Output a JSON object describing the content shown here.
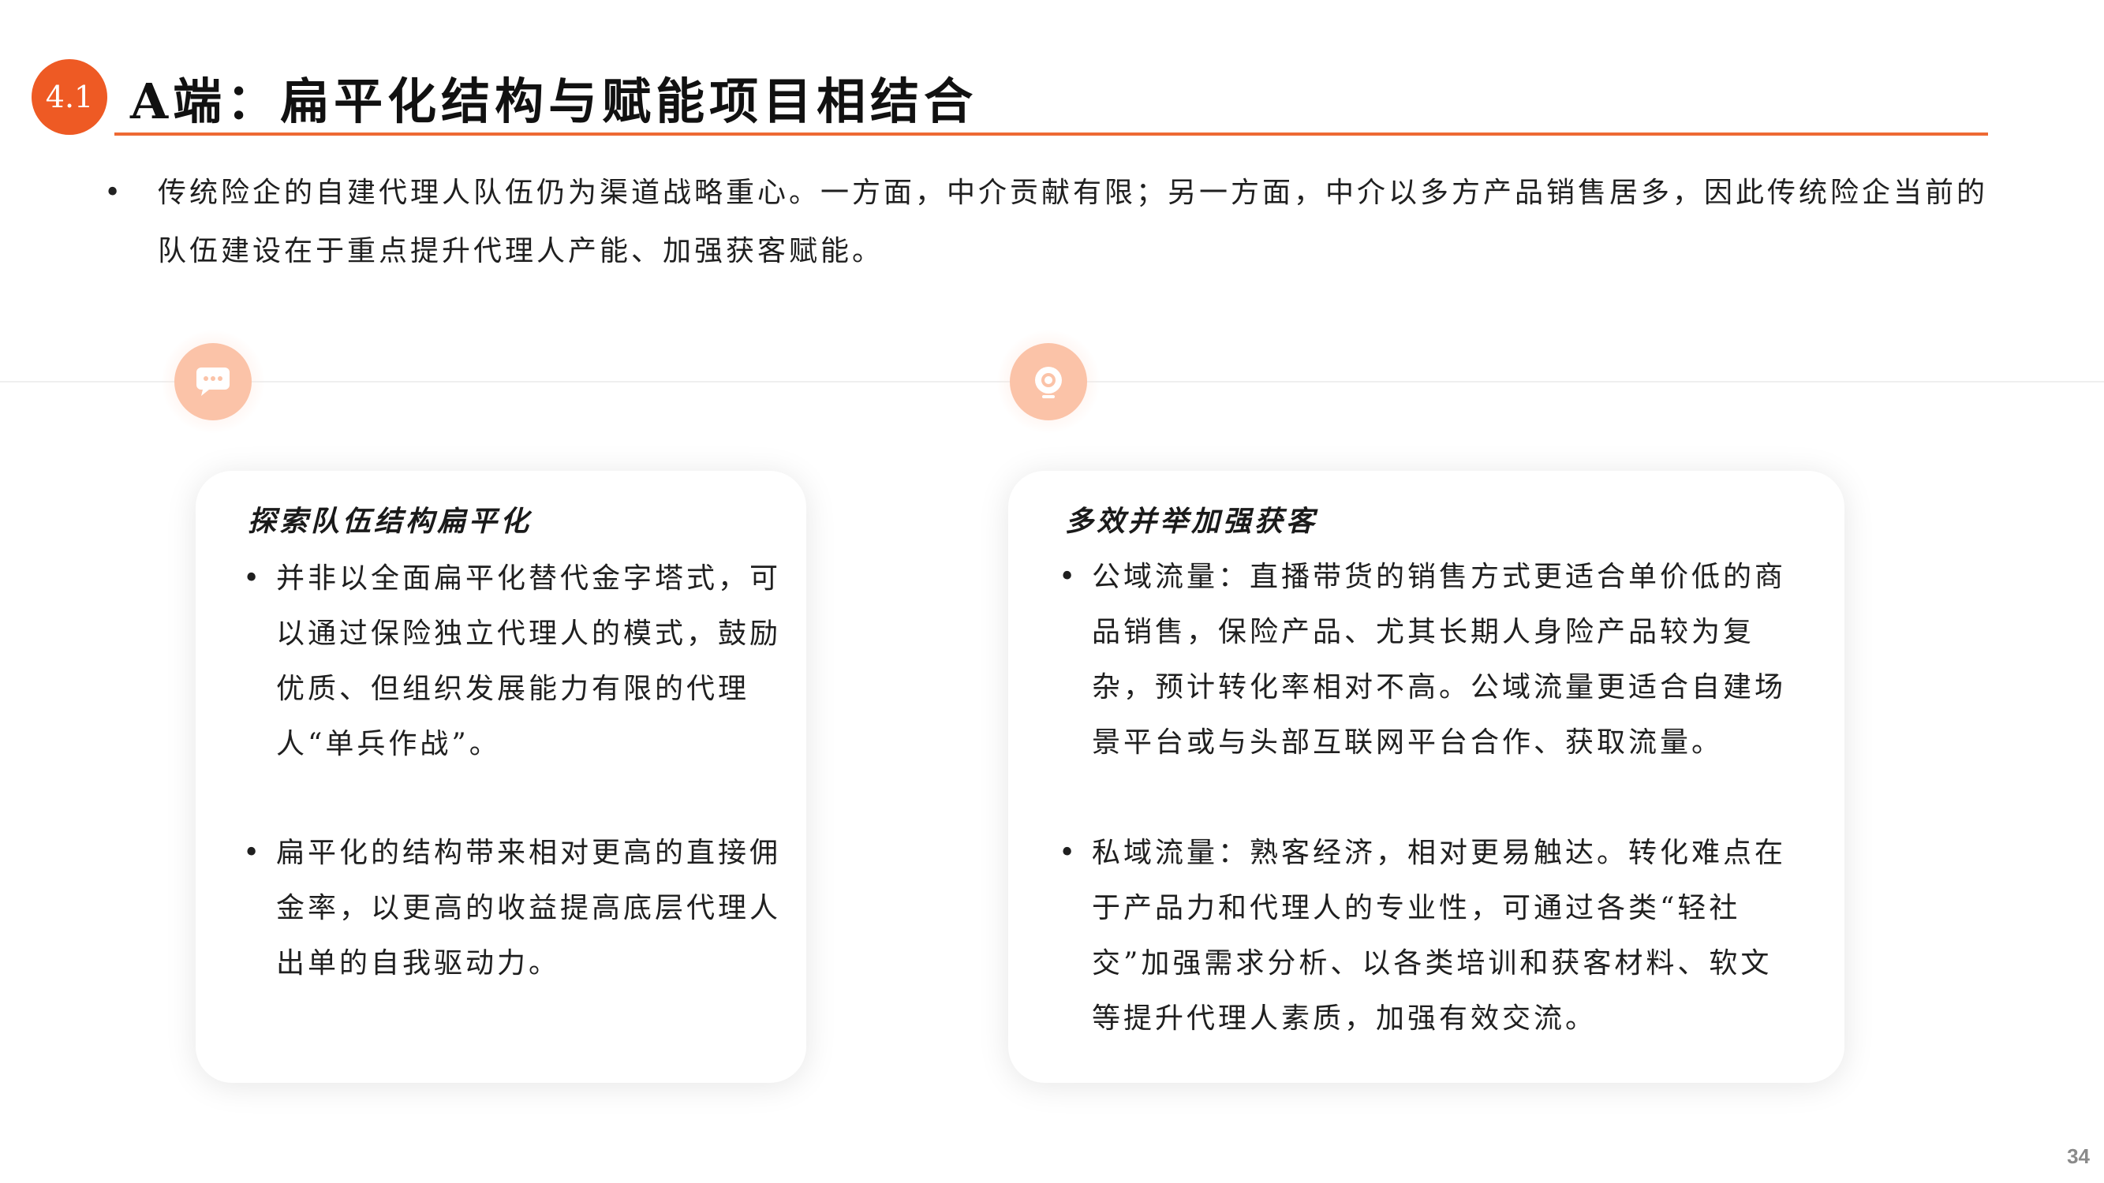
{
  "header": {
    "section_number": "4.1",
    "title": "A端：扁平化结构与赋能项目相结合"
  },
  "intro": {
    "bullet": "•",
    "text": "传统险企的自建代理人队伍仍为渠道战略重心。一方面，中介贡献有限；另一方面，中介以多方产品销售居多，因此传统险企当前的队伍建设在于重点提升代理人产能、加强获客赋能。"
  },
  "timeline": {
    "left_icon": "chat-bubble-icon",
    "right_icon": "target-icon",
    "accent_color": "#fbc3a8"
  },
  "cards": [
    {
      "title": "探索队伍结构扁平化",
      "bullets": [
        "并非以全面扁平化替代金字塔式，可以通过保险独立代理人的模式，鼓励优质、但组织发展能力有限的代理人“单兵作战”。",
        "扁平化的结构带来相对更高的直接佣金率，以更高的收益提高底层代理人出单的自我驱动力。"
      ]
    },
    {
      "title": "多效并举加强获客",
      "bullets": [
        "公域流量：直播带货的销售方式更适合单价低的商品销售，保险产品、尤其长期人身险产品较为复杂，预计转化率相对不高。公域流量更适合自建场景平台或与头部互联网平台合作、获取流量。",
        "私域流量：熟客经济，相对更易触达。转化难点在于产品力和代理人的专业性，可通过各类“轻社交”加强需求分析、以各类培训和获客材料、软文等提升代理人素质，加强有效交流。"
      ]
    }
  ],
  "footer": {
    "page_number": "34"
  },
  "colors": {
    "brand_orange": "#ee5a24",
    "rule_orange": "#ee6a34"
  }
}
